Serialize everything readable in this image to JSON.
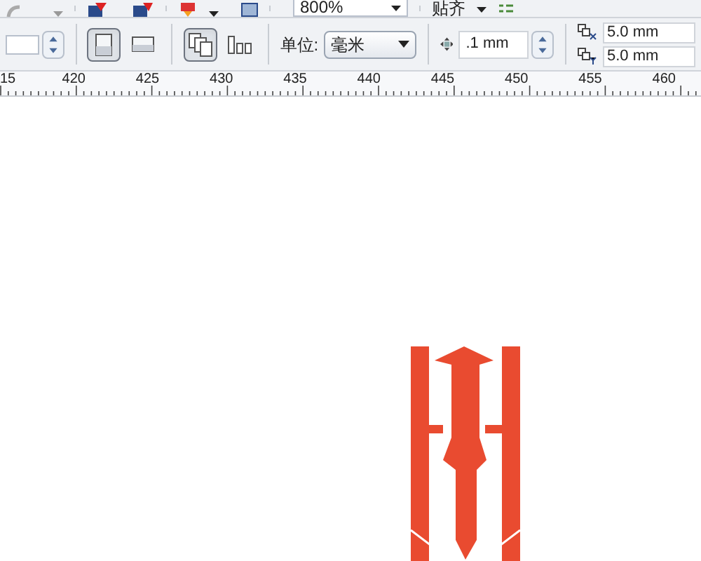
{
  "standard_toolbar": {
    "zoom": {
      "value": "800%"
    },
    "snap": {
      "label": "贴齐"
    }
  },
  "property_bar": {
    "orientation": [
      {
        "kind": "portrait",
        "selected": true
      },
      {
        "kind": "landscape",
        "selected": false
      }
    ],
    "page_scope": [
      {
        "kind": "all_pages",
        "selected": true
      },
      {
        "kind": "current_page",
        "selected": false
      }
    ],
    "units": {
      "label": "单位:",
      "value": "毫米"
    },
    "nudge": {
      "value": ".1 mm"
    },
    "duplicate": {
      "x": "5.0 mm",
      "y": "5.0 mm"
    }
  },
  "ruler": {
    "labels": [
      "15",
      "420",
      "425",
      "430",
      "435",
      "440",
      "445",
      "450",
      "455",
      "460"
    ]
  }
}
